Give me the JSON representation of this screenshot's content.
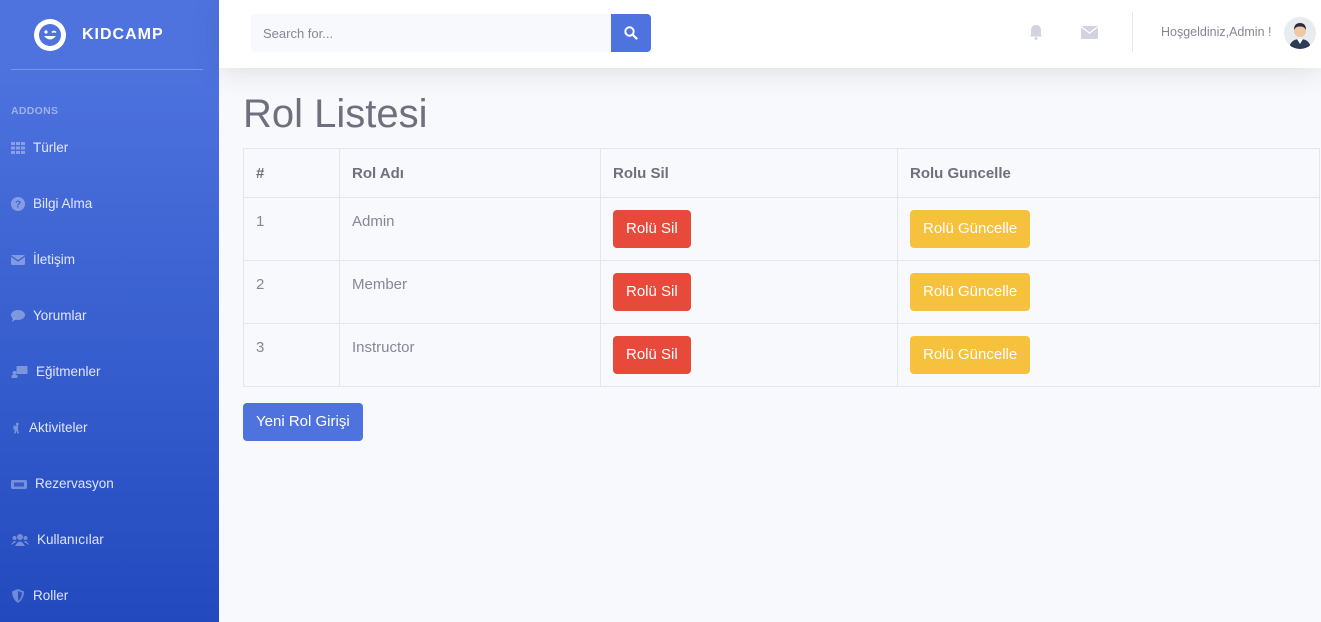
{
  "sidebar": {
    "brand": "KIDCAMP",
    "heading": "ADDONS",
    "items": [
      {
        "label": "Türler",
        "icon": "grid-icon"
      },
      {
        "label": "Bilgi Alma",
        "icon": "question-circle-icon"
      },
      {
        "label": "İletişim",
        "icon": "envelope-icon"
      },
      {
        "label": "Yorumlar",
        "icon": "comment-icon"
      },
      {
        "label": "Eğitmenler",
        "icon": "chalkboard-teacher-icon"
      },
      {
        "label": "Aktiviteler",
        "icon": "hiking-icon"
      },
      {
        "label": "Rezervasyon",
        "icon": "ticket-icon"
      },
      {
        "label": "Kullanıcılar",
        "icon": "users-icon"
      },
      {
        "label": "Roller",
        "icon": "shield-icon"
      }
    ]
  },
  "topbar": {
    "search_placeholder": "Search for...",
    "welcome": "Hoşgeldiniz,Admin !"
  },
  "main": {
    "title": "Rol Listesi",
    "columns": [
      "#",
      "Rol Adı",
      "Rolu Sil",
      "Rolu Guncelle"
    ],
    "rows": [
      {
        "id": "1",
        "name": "Admin",
        "delete_label": "Rolü Sil",
        "update_label": "Rolü Güncelle"
      },
      {
        "id": "2",
        "name": "Member",
        "delete_label": "Rolü Sil",
        "update_label": "Rolü Güncelle"
      },
      {
        "id": "3",
        "name": "Instructor",
        "delete_label": "Rolü Sil",
        "update_label": "Rolü Güncelle"
      }
    ],
    "new_button": "Yeni Rol Girişi"
  },
  "colors": {
    "primary": "#4e73df",
    "danger": "#e74a3b",
    "warning": "#f6c23e"
  }
}
